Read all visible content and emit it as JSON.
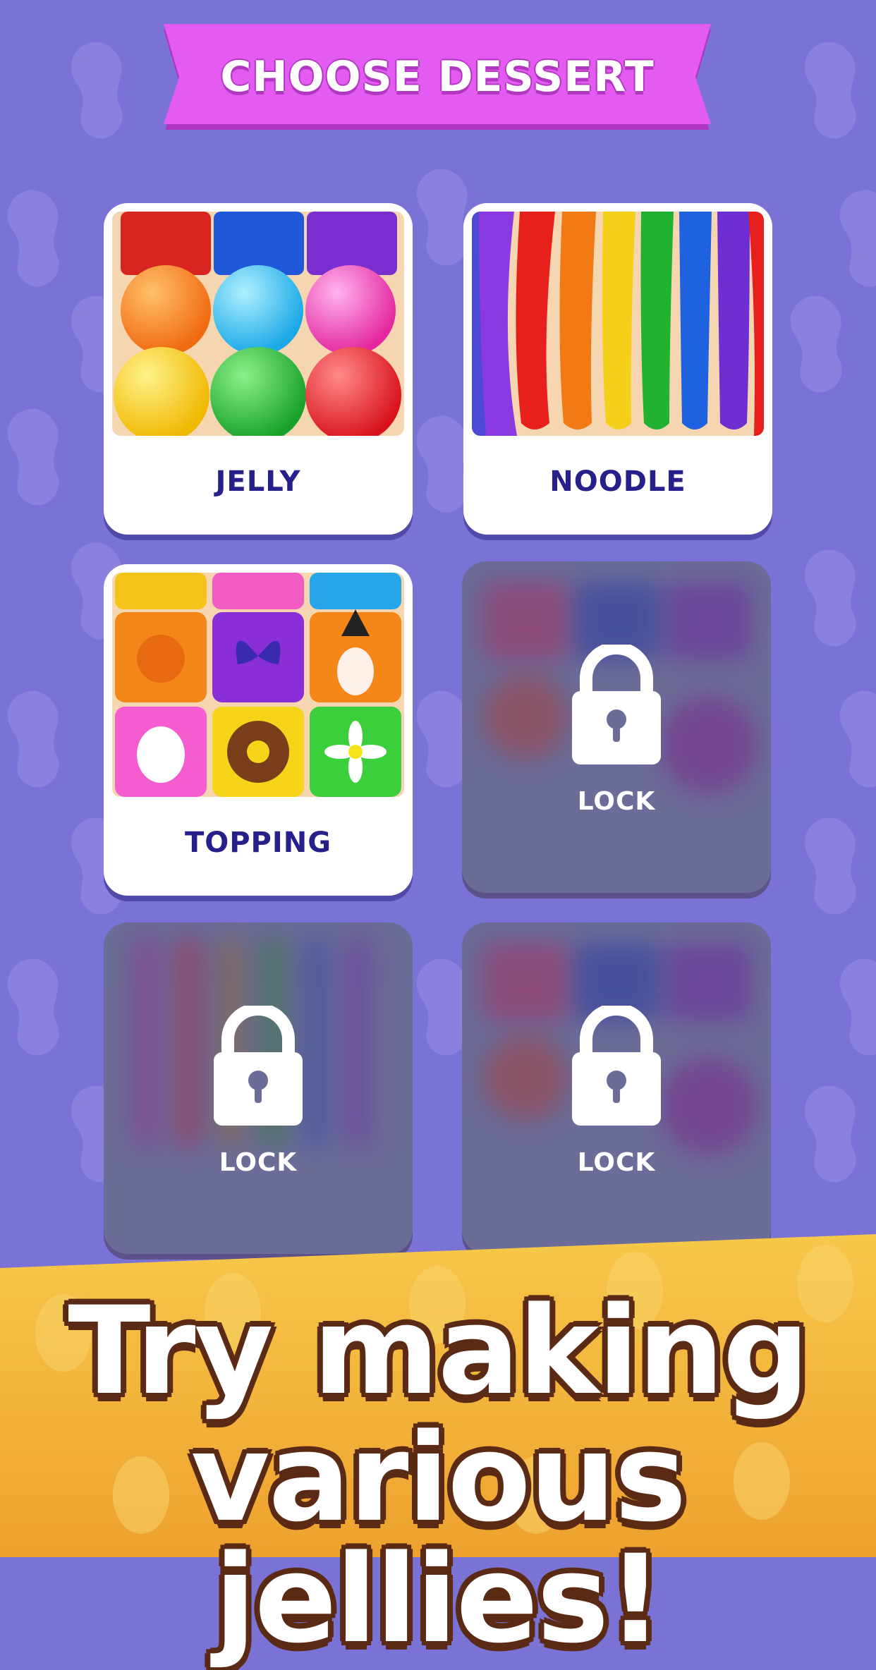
{
  "header": {
    "title": "CHOOSE DESSERT"
  },
  "cards": [
    {
      "label": "JELLY",
      "locked": false
    },
    {
      "label": "NOODLE",
      "locked": false
    },
    {
      "label": "TOPPING",
      "locked": false
    },
    {
      "label": "LOCK",
      "locked": true
    },
    {
      "label": "LOCK",
      "locked": true
    },
    {
      "label": "LOCK",
      "locked": true
    }
  ],
  "tagline": {
    "line1": "Try making",
    "line2": "various jellies!"
  },
  "colors": {
    "background": "#7b72d6",
    "banner": "#e35bf0",
    "card_label": "#27208a",
    "footer": "#f1b43a",
    "tagline_outline": "#5a2a14"
  }
}
